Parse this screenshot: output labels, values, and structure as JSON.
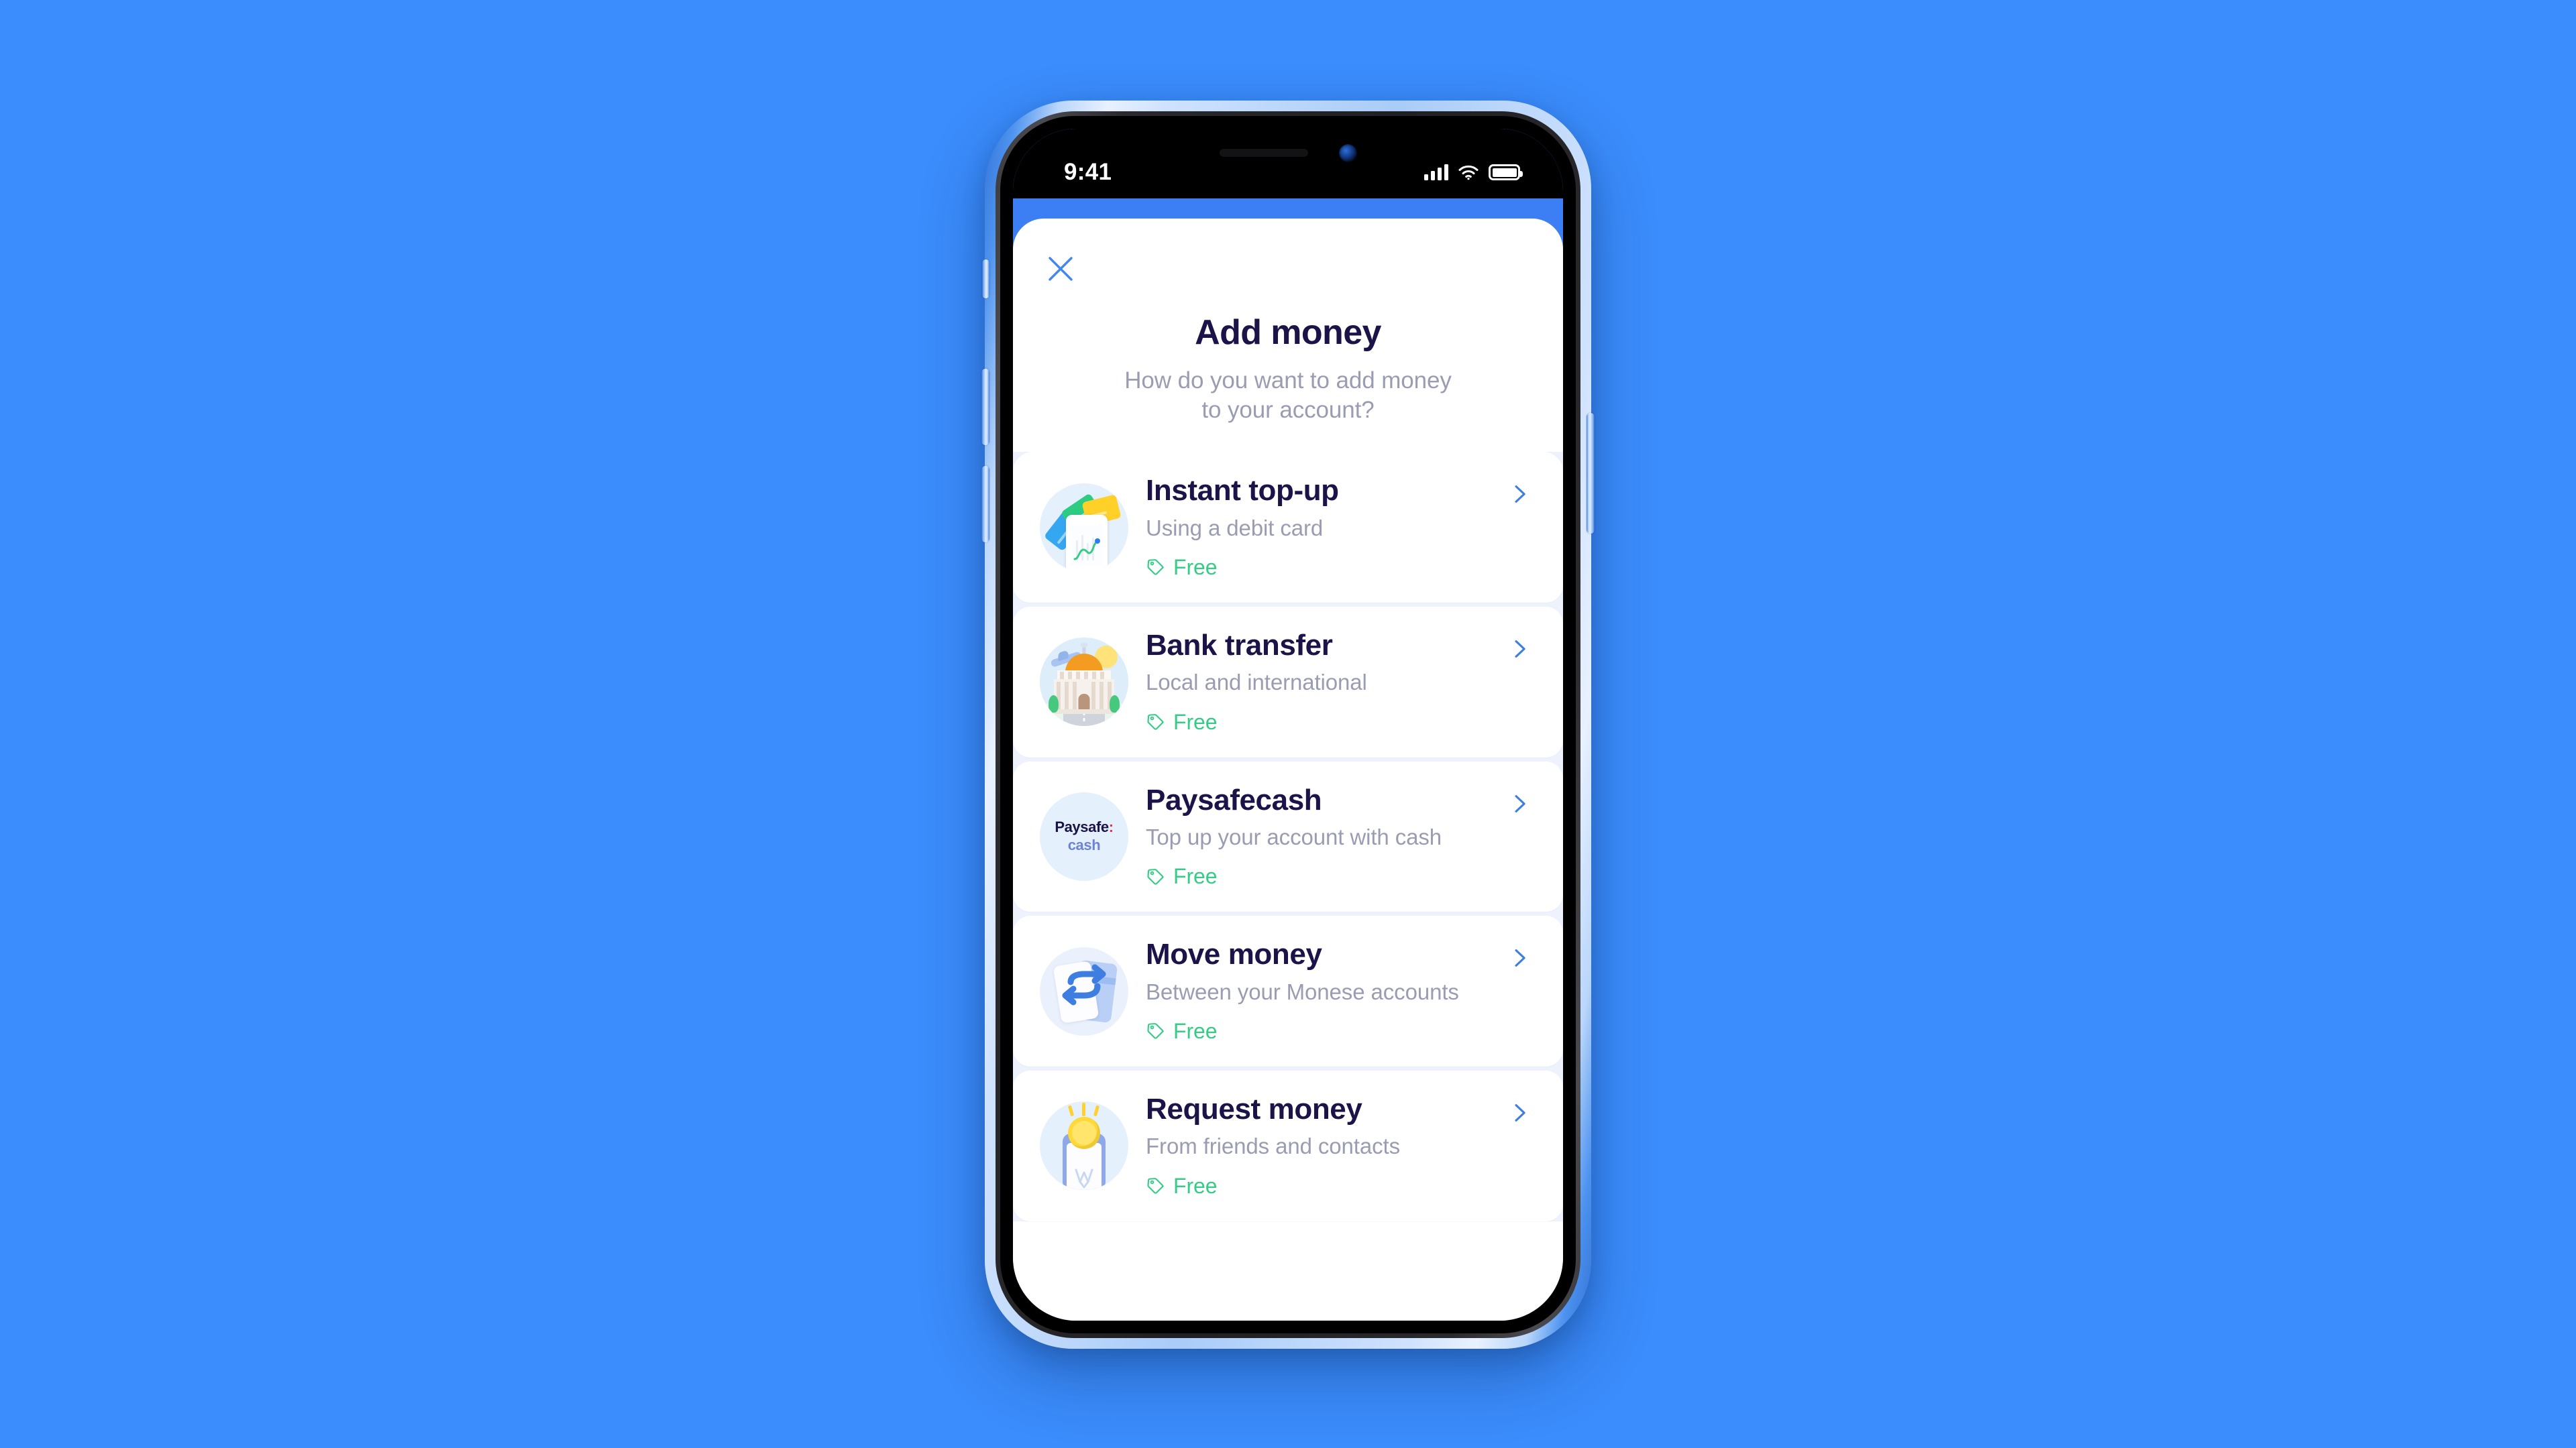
{
  "page": {
    "background_color": "#3B8CFC"
  },
  "device": {
    "frame_color": "#A9CCF8",
    "buttons": {
      "silent_switch": "silent-switch",
      "volume_up": "volume-up-button",
      "volume_down": "volume-down-button",
      "power": "power-button"
    }
  },
  "status_bar": {
    "time": "9:41",
    "icons": [
      "cellular-signal-icon",
      "wifi-icon",
      "battery-icon"
    ],
    "signal_bars": 4,
    "battery_full": true
  },
  "screen": {
    "accent_color": "#3C7FF5",
    "close_icon": "close-icon"
  },
  "header": {
    "title": "Add money",
    "subtitle_line1": "How do you want to add money",
    "subtitle_line2": "to your account?",
    "title_color": "#1C1449",
    "subtitle_color": "#9A9DB2"
  },
  "options": [
    {
      "id": "instant-top-up",
      "title": "Instant top-up",
      "subtitle": "Using a debit card",
      "fee": "Free",
      "fee_icon": "price-tag-icon",
      "chevron_icon": "chevron-right-icon",
      "illustration": "cards-and-phone-icon"
    },
    {
      "id": "bank-transfer",
      "title": "Bank transfer",
      "subtitle": "Local and international",
      "fee": "Free",
      "fee_icon": "price-tag-icon",
      "chevron_icon": "chevron-right-icon",
      "illustration": "bank-building-icon"
    },
    {
      "id": "paysafecash",
      "title": "Paysafecash",
      "subtitle": "Top up your account with cash",
      "fee": "Free",
      "fee_icon": "price-tag-icon",
      "chevron_icon": "chevron-right-icon",
      "illustration": "paysafecash-logo-icon",
      "logo_text_top": "Paysafe",
      "logo_text_colon": ":",
      "logo_text_bottom": "cash"
    },
    {
      "id": "move-money",
      "title": "Move money",
      "subtitle": "Between your Monese accounts",
      "fee": "Free",
      "fee_icon": "price-tag-icon",
      "chevron_icon": "chevron-right-icon",
      "illustration": "exchange-cards-icon"
    },
    {
      "id": "request-money",
      "title": "Request money",
      "subtitle": "From friends and contacts",
      "fee": "Free",
      "fee_icon": "price-tag-icon",
      "chevron_icon": "chevron-right-icon",
      "illustration": "coin-into-phone-icon"
    }
  ],
  "colors": {
    "fee_green": "#35CC86",
    "chevron_blue": "#3D7EE0",
    "close_blue": "#4285F4",
    "list_gap": "#EDF2FD"
  }
}
